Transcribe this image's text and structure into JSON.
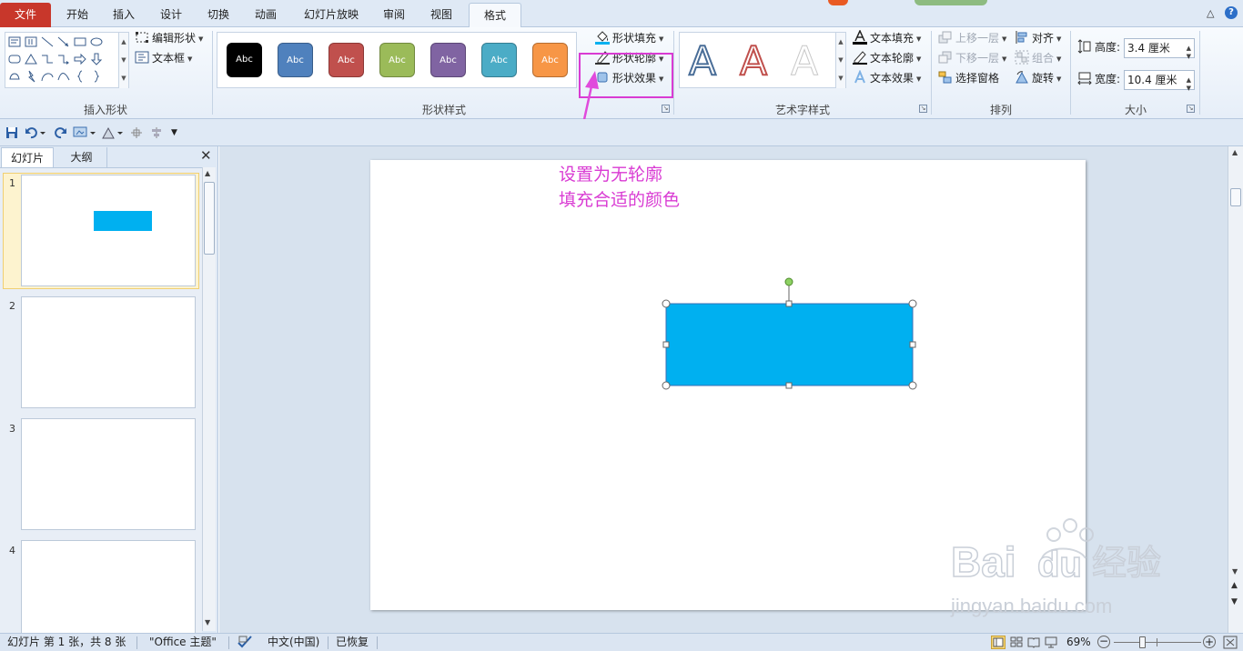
{
  "tabs": [
    {
      "label": "文件"
    },
    {
      "label": "开始"
    },
    {
      "label": "插入"
    },
    {
      "label": "设计"
    },
    {
      "label": "切换"
    },
    {
      "label": "动画"
    },
    {
      "label": "幻灯片放映"
    },
    {
      "label": "审阅"
    },
    {
      "label": "视图"
    },
    {
      "label": "格式"
    }
  ],
  "ribbon": {
    "insert_shapes": {
      "label": "插入形状",
      "edit_shape": "编辑形状",
      "text_box": "文本框"
    },
    "shape_styles": {
      "label": "形状样式",
      "presets": [
        {
          "text": "Abc",
          "color": "#000000"
        },
        {
          "text": "Abc",
          "color": "#4f81bd"
        },
        {
          "text": "Abc",
          "color": "#c0504d"
        },
        {
          "text": "Abc",
          "color": "#9bbb59"
        },
        {
          "text": "Abc",
          "color": "#8064a2"
        },
        {
          "text": "Abc",
          "color": "#4bacc6"
        },
        {
          "text": "Abc",
          "color": "#f79646"
        }
      ],
      "shape_fill": "形状填充",
      "shape_outline": "形状轮廓",
      "shape_effects": "形状效果"
    },
    "wordart_styles": {
      "label": "艺术字样式",
      "samples": [
        "A",
        "A",
        "A"
      ],
      "text_fill": "文本填充",
      "text_outline": "文本轮廓",
      "text_effects": "文本效果"
    },
    "arrange": {
      "label": "排列",
      "bring_forward": "上移一层",
      "send_backward": "下移一层",
      "selection_pane": "选择窗格",
      "align": "对齐",
      "group": "组合",
      "rotate": "旋转"
    },
    "size": {
      "label": "大小",
      "height_label": "高度:",
      "height_value": "3.4 厘米",
      "width_label": "宽度:",
      "width_value": "10.4 厘米"
    }
  },
  "left_pane": {
    "tab_slides": "幻灯片",
    "tab_outline": "大纲",
    "slides": [
      {
        "number": "1"
      },
      {
        "number": "2"
      },
      {
        "number": "3"
      },
      {
        "number": "4"
      }
    ]
  },
  "annotation": {
    "line1": "设置为无轮廓",
    "line2": "填充合适的颜色",
    "color": "#d93bd3"
  },
  "slide": {
    "shape_fill": "#00b0f0"
  },
  "status": {
    "slide_info": "幻灯片 第 1 张，共 8 张",
    "theme": "\"Office 主题\"",
    "language": "中文(中国)",
    "recovered": "已恢复",
    "zoom": "69%"
  },
  "watermark": {
    "brand": "Baidu 经验",
    "url": "jingyan.baidu.com"
  }
}
